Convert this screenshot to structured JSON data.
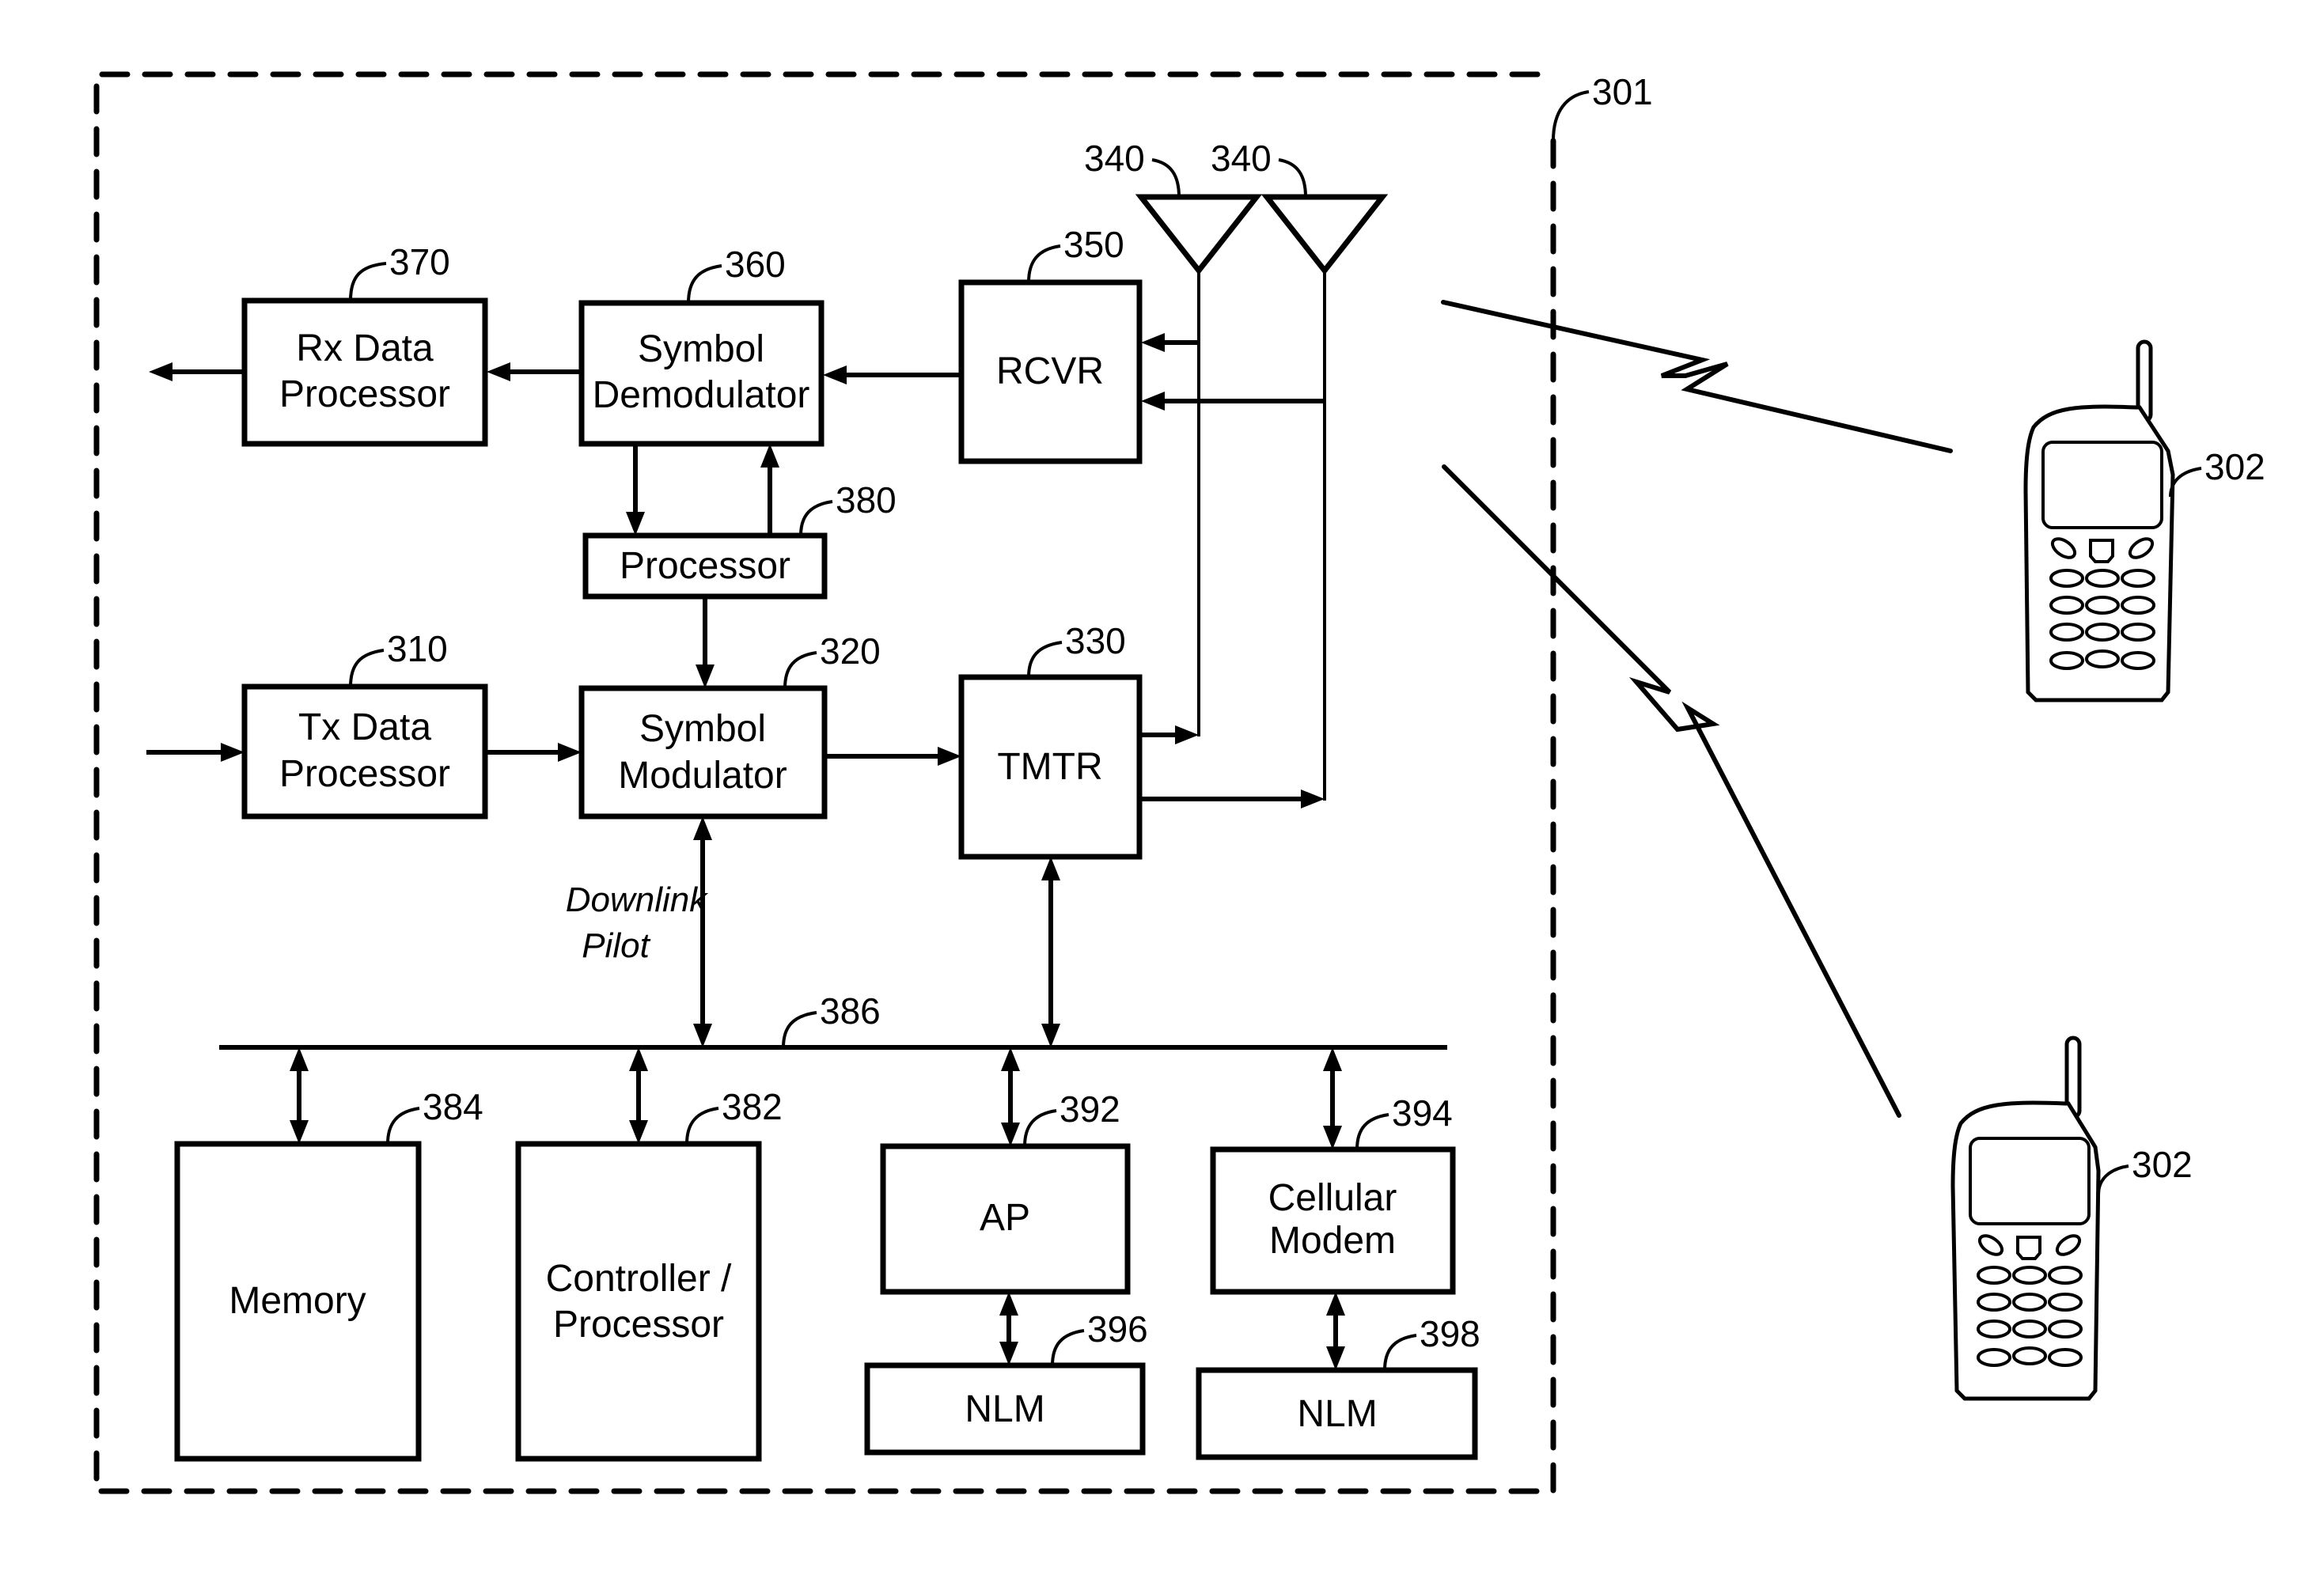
{
  "diagram": {
    "type": "block-diagram",
    "title": "",
    "base_station": {
      "ref": "301",
      "blocks": [
        {
          "id": "rx_data_processor",
          "ref": "370",
          "lines": [
            "Rx Data",
            "Processor"
          ]
        },
        {
          "id": "symbol_demodulator",
          "ref": "360",
          "lines": [
            "Symbol",
            "Demodulator"
          ]
        },
        {
          "id": "rcvr",
          "ref": "350",
          "lines": [
            "RCVR"
          ]
        },
        {
          "id": "processor",
          "ref": "380",
          "lines": [
            "Processor"
          ]
        },
        {
          "id": "tx_data_processor",
          "ref": "310",
          "lines": [
            "Tx Data",
            "Processor"
          ]
        },
        {
          "id": "symbol_modulator",
          "ref": "320",
          "lines": [
            "Symbol",
            "Modulator"
          ]
        },
        {
          "id": "tmtr",
          "ref": "330",
          "lines": [
            "TMTR"
          ]
        },
        {
          "id": "memory",
          "ref": "384",
          "lines": [
            "Memory"
          ]
        },
        {
          "id": "controller_processor",
          "ref": "382",
          "lines": [
            "Controller /",
            "Processor"
          ]
        },
        {
          "id": "ap",
          "ref": "392",
          "lines": [
            "AP"
          ]
        },
        {
          "id": "cellular_modem",
          "ref": "394",
          "lines": [
            "Cellular",
            "Modem"
          ]
        },
        {
          "id": "nlm_ap",
          "ref": "396",
          "lines": [
            "NLM"
          ]
        },
        {
          "id": "nlm_modem",
          "ref": "398",
          "lines": [
            "NLM"
          ]
        }
      ],
      "antennas": [
        {
          "ref": "340"
        },
        {
          "ref": "340"
        }
      ],
      "bus": {
        "ref": "386"
      },
      "annotation": [
        "Downlink",
        "Pilot"
      ]
    },
    "terminals": [
      {
        "ref": "302"
      },
      {
        "ref": "302"
      }
    ],
    "connections": [
      {
        "from": "symbol_demodulator",
        "to": "rx_data_processor"
      },
      {
        "from": "rx_data_processor",
        "to": "output"
      },
      {
        "from": "rcvr",
        "to": "symbol_demodulator"
      },
      {
        "from": "antenna_1",
        "to": "rcvr"
      },
      {
        "from": "antenna_2",
        "to": "rcvr"
      },
      {
        "from": "symbol_demodulator",
        "to": "processor"
      },
      {
        "from": "processor",
        "to": "symbol_demodulator"
      },
      {
        "from": "processor",
        "to": "symbol_modulator"
      },
      {
        "from": "input",
        "to": "tx_data_processor"
      },
      {
        "from": "tx_data_processor",
        "to": "symbol_modulator"
      },
      {
        "from": "symbol_modulator",
        "to": "tmtr"
      },
      {
        "from": "tmtr",
        "to": "antenna_1"
      },
      {
        "from": "tmtr",
        "to": "antenna_2"
      },
      {
        "from": "symbol_modulator",
        "to": "bus",
        "bidirectional": true
      },
      {
        "from": "tmtr",
        "to": "bus",
        "bidirectional": true
      },
      {
        "from": "memory",
        "to": "bus",
        "bidirectional": true
      },
      {
        "from": "controller_processor",
        "to": "bus",
        "bidirectional": true
      },
      {
        "from": "ap",
        "to": "bus",
        "bidirectional": true
      },
      {
        "from": "cellular_modem",
        "to": "bus",
        "bidirectional": true
      },
      {
        "from": "ap",
        "to": "nlm_ap",
        "bidirectional": true
      },
      {
        "from": "cellular_modem",
        "to": "nlm_modem",
        "bidirectional": true
      },
      {
        "from": "base_station",
        "to": "terminal_1",
        "kind": "wireless"
      },
      {
        "from": "base_station",
        "to": "terminal_2",
        "kind": "wireless"
      }
    ]
  }
}
